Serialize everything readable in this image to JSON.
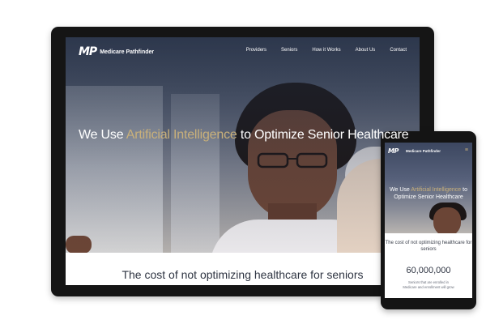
{
  "site": {
    "logo_mark": "MP",
    "brand_name": "Medicare Pathfinder"
  },
  "nav": {
    "items": [
      "Providers",
      "Seniors",
      "How it Works",
      "About Us",
      "Contact"
    ]
  },
  "hero": {
    "title_pre": "We Use ",
    "title_accent": "Artificial Intelligence",
    "title_post": " to Optimize Senior Healthcare"
  },
  "section": {
    "title": "The cost of not optimizing healthcare for seniors"
  },
  "mobile": {
    "menu_icon": "hamburger-menu-icon",
    "hero_title_pre": "We Use ",
    "hero_title_accent": "Artificial Intelligence",
    "hero_title_post": " to Optimize Senior Healthcare",
    "cost_text": "The cost of not optimizing healthcare for seniors",
    "stat_number": "60,000,000",
    "stat_desc_line1": "Seniors that are enrolled in",
    "stat_desc_line2": "Medicare and enrollment will grow"
  },
  "colors": {
    "accent": "#c9b07a",
    "heading": "#2e3442",
    "device_frame": "#151515"
  }
}
